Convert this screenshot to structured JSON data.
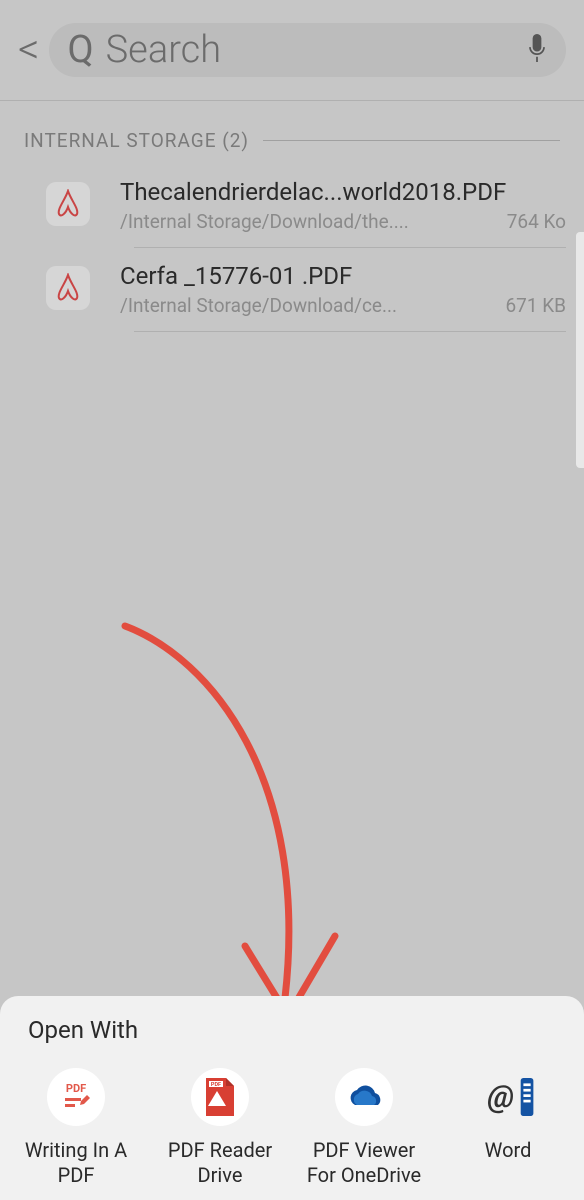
{
  "header": {
    "back_symbol": "<",
    "search_placeholder": "Search"
  },
  "section": {
    "label": "INTERNAL STORAGE (2)"
  },
  "files": [
    {
      "name": "Thecalendrierdelac...world2018.PDF",
      "path": "/Internal Storage/Download/the....",
      "size": "764 Ko"
    },
    {
      "name": "Cerfa _15776-01 .PDF",
      "path": "/Internal Storage/Download/ce...",
      "size": "671 KB"
    }
  ],
  "sheet": {
    "title": "Open With",
    "apps": [
      {
        "label": "Writing In A\nPDF"
      },
      {
        "label": "PDF Reader\nDrive"
      },
      {
        "label": "PDF Viewer\nFor OneDrive"
      },
      {
        "label": "Word"
      }
    ]
  }
}
